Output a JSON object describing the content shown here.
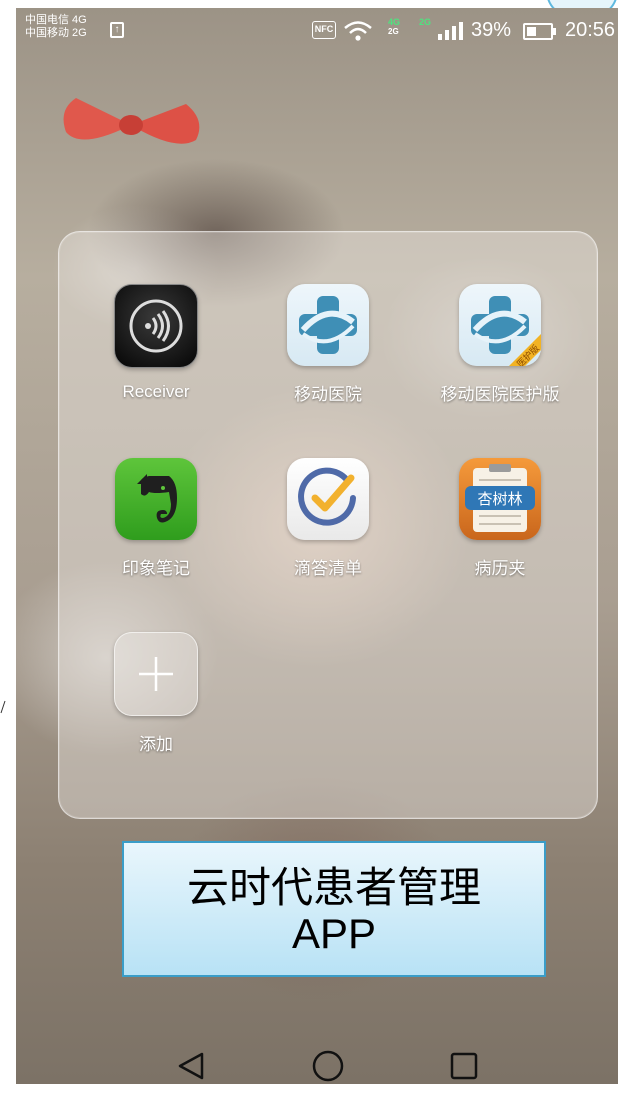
{
  "status_bar": {
    "carrier_1": "中国电信 4G",
    "carrier_2": "中国移动 2G",
    "nfc_label": "NFC",
    "net_1": "4G",
    "net_2": "2G",
    "battery_percent": "39%",
    "battery_level": 0.39,
    "time": "20:56"
  },
  "folder": {
    "apps": [
      {
        "label": "Receiver",
        "icon": "receiver-nfc-icon"
      },
      {
        "label": "移动医院",
        "icon": "mobile-hospital-icon"
      },
      {
        "label": "移动医院医护版",
        "icon": "mobile-hospital-medical-icon",
        "badge": "医护版"
      },
      {
        "label": "印象笔记",
        "icon": "evernote-elephant-icon"
      },
      {
        "label": "滴答清单",
        "icon": "ticktick-check-icon"
      },
      {
        "label": "病历夹",
        "icon": "medical-record-clipboard-icon",
        "badge": "杏树林"
      },
      {
        "label": "添加",
        "icon": "plus-icon"
      }
    ]
  },
  "caption": {
    "line_1": "云时代患者管理",
    "line_2": "APP"
  },
  "navigation": {
    "back": "back-triangle-icon",
    "home": "home-circle-icon",
    "recents": "recents-square-icon"
  },
  "colors": {
    "caption_border": "#3a9dc8",
    "caption_fill": "#b8e2f5",
    "network_green": "#4fe37f"
  }
}
